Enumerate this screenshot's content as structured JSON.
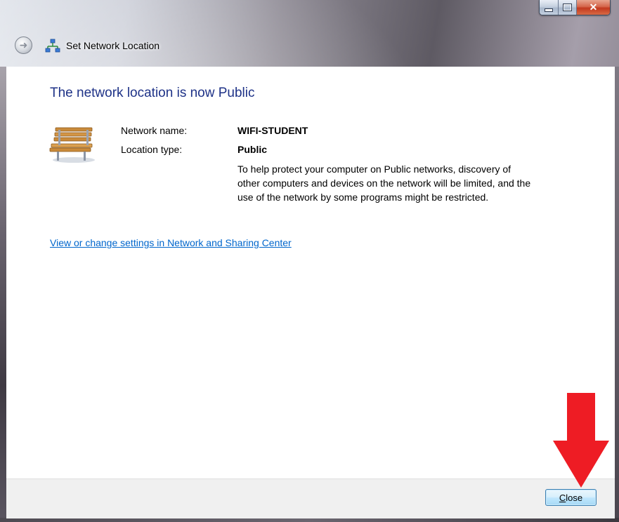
{
  "window": {
    "title": "Set Network Location",
    "controls": [
      "minimize",
      "maximize",
      "close"
    ]
  },
  "main": {
    "heading": "The network location is now Public",
    "network_name_label": "Network name:",
    "network_name_value": "WIFI-STUDENT",
    "location_type_label": "Location type:",
    "location_type_value": "Public",
    "description": "To help protect your computer on Public networks, discovery of other computers and devices on the network will be limited, and the use of the network by some programs might be restricted.",
    "settings_link": "View or change settings in Network and Sharing Center"
  },
  "footer": {
    "close_button_label": "Close"
  },
  "icons": {
    "back": "back-arrow-icon",
    "title": "network-icon",
    "location": "park-bench-icon",
    "annotation": "red-down-arrow"
  },
  "colors": {
    "heading": "#1e3287",
    "link": "#0066cc",
    "annotation_arrow": "#ee1c24"
  }
}
